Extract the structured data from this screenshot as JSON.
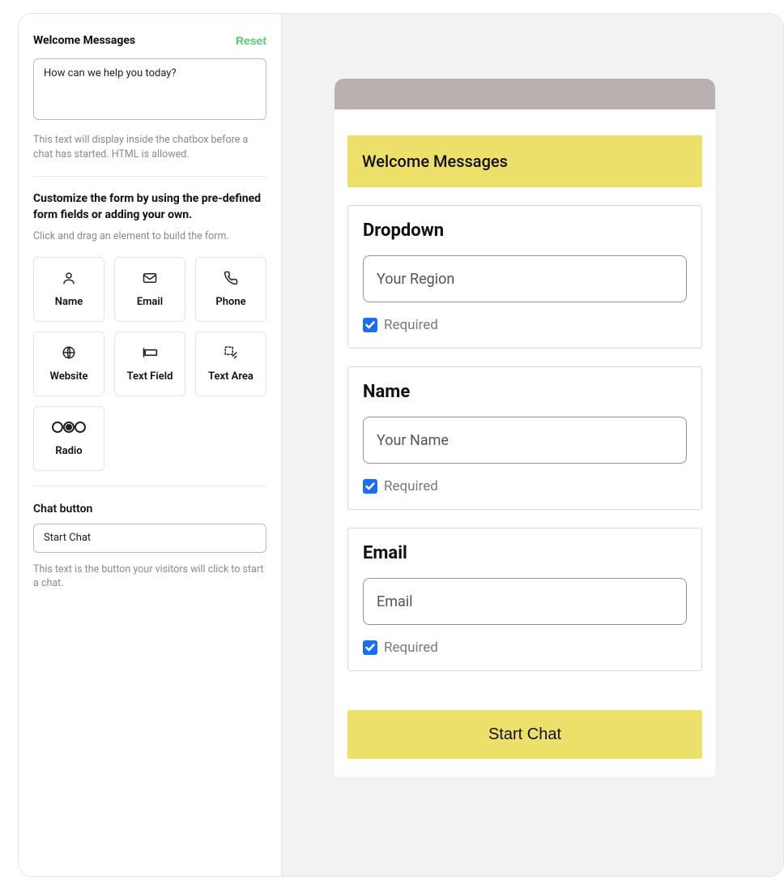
{
  "sidebar": {
    "welcome_heading": "Welcome Messages",
    "reset_label": "Reset",
    "welcome_value": "How can we help you today?",
    "welcome_help": "This text will display inside the chatbox before a chat has started. HTML is allowed.",
    "customize_heading": "Customize the form by using the pre-defined form fields or adding your own.",
    "customize_help": "Click and drag an element to build the form.",
    "palette": [
      {
        "label": "Name",
        "icon": "person-icon"
      },
      {
        "label": "Email",
        "icon": "mail-icon"
      },
      {
        "label": "Phone",
        "icon": "phone-icon"
      },
      {
        "label": "Website",
        "icon": "globe-icon"
      },
      {
        "label": "Text Field",
        "icon": "textfield-icon"
      },
      {
        "label": "Text Area",
        "icon": "textarea-icon"
      },
      {
        "label": "Radio",
        "icon": "radio-icon"
      }
    ],
    "chat_button_heading": "Chat button",
    "chat_button_value": "Start Chat",
    "chat_button_help": "This text is the button your visitors will click to start a chat."
  },
  "preview": {
    "welcome_banner": "Welcome Messages",
    "required_label": "Required",
    "fields": [
      {
        "title": "Dropdown",
        "placeholder": "Your Region",
        "required": true
      },
      {
        "title": "Name",
        "placeholder": "Your Name",
        "required": true
      },
      {
        "title": "Email",
        "placeholder": "Email",
        "required": true
      }
    ],
    "start_button": "Start Chat"
  }
}
